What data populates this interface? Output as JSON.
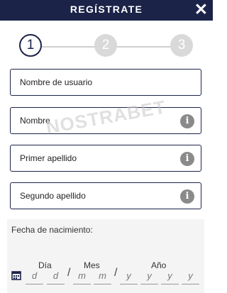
{
  "header": {
    "title": "REGÍSTRATE",
    "close_glyph": "✕"
  },
  "steps": [
    {
      "label": "1",
      "state": "active"
    },
    {
      "label": "2",
      "state": "inactive"
    },
    {
      "label": "3",
      "state": "inactive"
    }
  ],
  "fields": {
    "username": {
      "placeholder": "Nombre de usuario"
    },
    "name": {
      "placeholder": "Nombre",
      "info": "i"
    },
    "first_surname": {
      "placeholder": "Primer apellido",
      "info": "i"
    },
    "second_surname": {
      "placeholder": "Segundo apellido",
      "info": "i"
    }
  },
  "watermark": "NOSTRABET",
  "birthdate": {
    "label": "Fecha de nacimiento:",
    "day_label": "Día",
    "month_label": "Mes",
    "year_label": "Año",
    "day_slots": [
      "d",
      "d"
    ],
    "month_slots": [
      "m",
      "m"
    ],
    "year_slots": [
      "y",
      "y",
      "y",
      "y"
    ],
    "separator": "/"
  },
  "colors": {
    "primary": "#1c2349",
    "inactive_step": "#d9d9d9",
    "info_icon": "#8a8a8a"
  }
}
